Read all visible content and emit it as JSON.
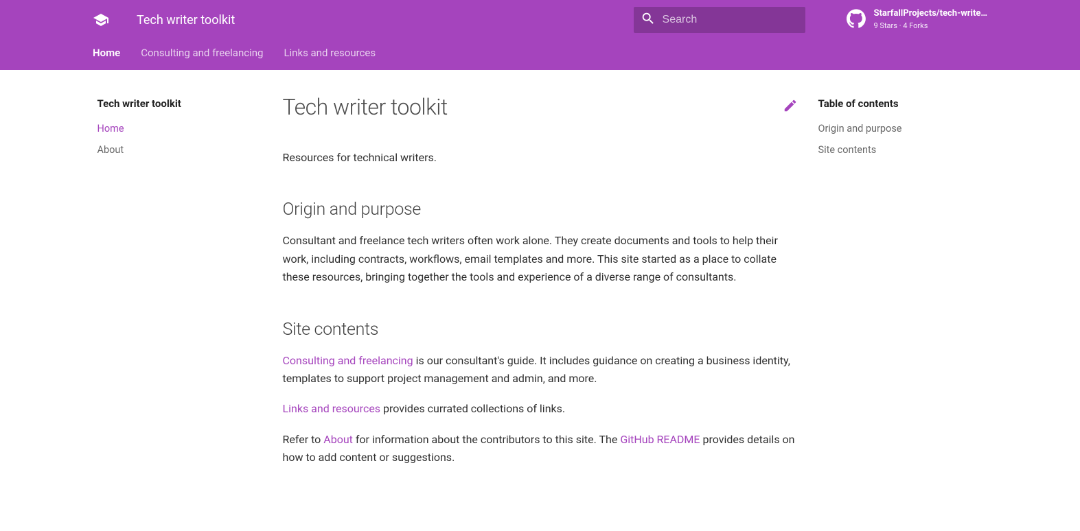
{
  "header": {
    "site_title": "Tech writer toolkit",
    "search_placeholder": "Search",
    "repo": {
      "name": "StarfallProjects/tech-write…",
      "stats": "9 Stars · 4 Forks"
    },
    "tabs": [
      {
        "label": "Home",
        "active": true
      },
      {
        "label": "Consulting and freelancing",
        "active": false
      },
      {
        "label": "Links and resources",
        "active": false
      }
    ]
  },
  "sidebar": {
    "title": "Tech writer toolkit",
    "items": [
      {
        "label": "Home",
        "active": true
      },
      {
        "label": "About",
        "active": false
      }
    ]
  },
  "main": {
    "h1": "Tech writer toolkit",
    "intro": "Resources for technical writers.",
    "h2_origin": "Origin and purpose",
    "p_origin": "Consultant and freelance tech writers often work alone. They create documents and tools to help their work, including contracts, workflows, email templates and more. This site started as a place to collate these resources, bringing together the tools and experience of a diverse range of consultants.",
    "h2_site": "Site contents",
    "link_consulting": "Consulting and freelancing",
    "p_consulting_rest": " is our consultant's guide. It includes guidance on creating a business identity, templates to support project management and admin, and more.",
    "link_links": "Links and resources",
    "p_links_rest": " provides currated collections of links.",
    "refer_pre": "Refer to ",
    "link_about": "About",
    "refer_mid": " for information about the contributors to this site. The ",
    "link_readme": "GitHub README",
    "refer_post": " provides details on how to add content or suggestions."
  },
  "toc": {
    "title": "Table of contents",
    "items": [
      {
        "label": "Origin and purpose"
      },
      {
        "label": "Site contents"
      }
    ]
  }
}
